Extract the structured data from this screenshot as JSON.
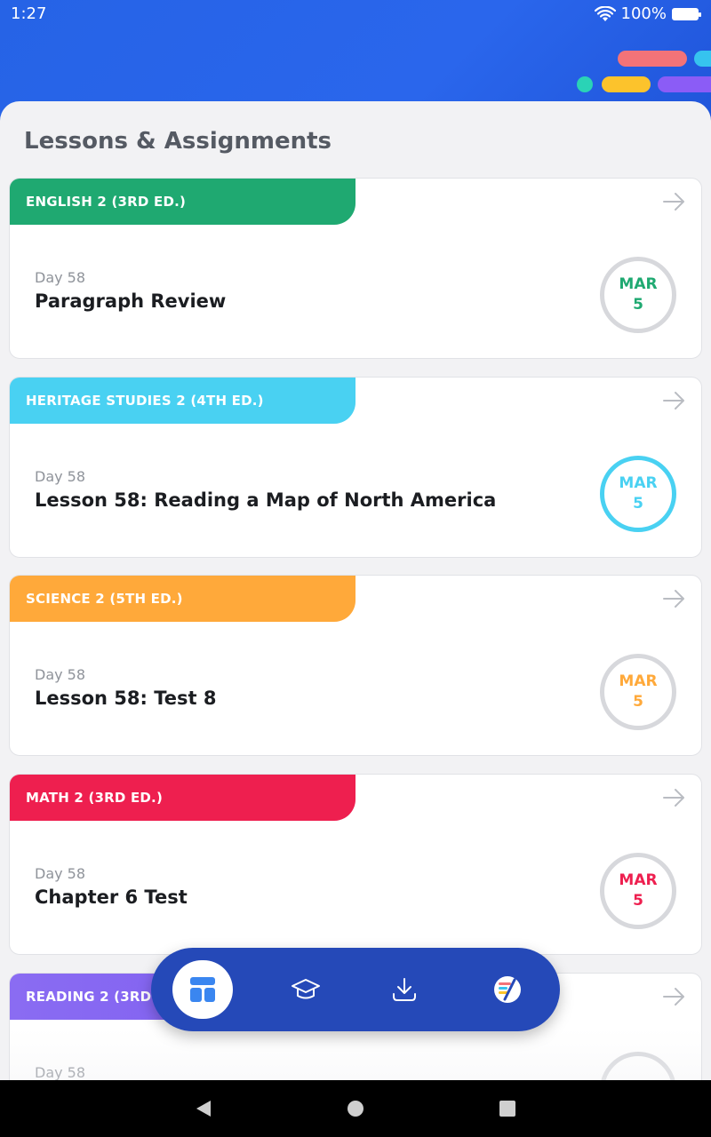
{
  "status_bar": {
    "time": "1:27",
    "battery": "100%"
  },
  "page_title": "Lessons & Assignments",
  "cards": [
    {
      "course": "ENGLISH 2 (3RD ED.)",
      "day": "Day 58",
      "lesson": "Paragraph Review",
      "month": "MAR",
      "date": "5",
      "color": "#1fa971",
      "circle_border": "#d7d8dc"
    },
    {
      "course": "HERITAGE STUDIES 2 (4TH ED.)",
      "day": "Day 58",
      "lesson": "Lesson 58: Reading a Map of North America",
      "month": "MAR",
      "date": "5",
      "color": "#49d1f2",
      "circle_border": "#49d1f2"
    },
    {
      "course": "SCIENCE 2 (5TH ED.)",
      "day": "Day 58",
      "lesson": "Lesson 58: Test 8",
      "month": "MAR",
      "date": "5",
      "color": "#ffa93a",
      "circle_border": "#d7d8dc"
    },
    {
      "course": "MATH 2 (3RD ED.)",
      "day": "Day 58",
      "lesson": "Chapter 6 Test",
      "month": "MAR",
      "date": "5",
      "color": "#ee1f4f",
      "circle_border": "#d7d8dc"
    },
    {
      "course": "READING 2 (3RD ED.)",
      "day": "Day 58",
      "lesson": "",
      "month": "",
      "date": "",
      "color": "#8a6cf2",
      "circle_border": "#d7d8dc"
    }
  ],
  "bottom_nav": {
    "items": [
      {
        "icon": "dashboard-icon",
        "active": true
      },
      {
        "icon": "graduation-cap-icon",
        "active": false
      },
      {
        "icon": "download-icon",
        "active": false
      },
      {
        "icon": "app-logo-icon",
        "active": false
      }
    ]
  },
  "colors": {
    "header": "#2663e6",
    "nav_bar": "#2549b8",
    "deco_red": "#f37378",
    "deco_cyan": "#36c3ef",
    "deco_teal": "#2ad3b6",
    "deco_yellow": "#fcc32c",
    "deco_purple": "#8b5cf6"
  }
}
